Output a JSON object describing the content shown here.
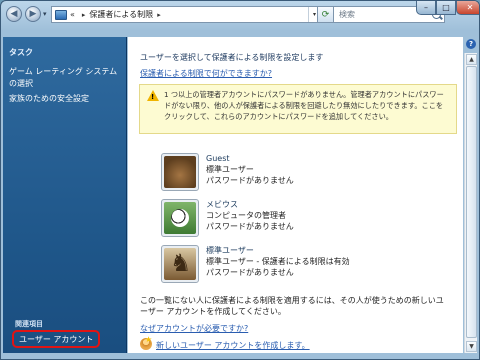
{
  "window": {
    "address_path": "保護者による制限",
    "address_chevron": "«",
    "search_placeholder": "検索",
    "buttons": {
      "minimize": "–",
      "maximize": "□",
      "close": "✕"
    },
    "help": "?"
  },
  "sidebar": {
    "heading": "タスク",
    "links": [
      "ゲーム レーティング システムの選択",
      "家族のための安全設定"
    ],
    "related_heading": "関連項目",
    "user_account": "ユーザー アカウント"
  },
  "main": {
    "title": "ユーザーを選択して保護者による制限を設定します",
    "faq_link": "保護者による制限で何ができますか?",
    "warning": "1 つ以上の管理者アカウントにパスワードがありません。管理者アカウントにパスワードがない限り、他の人が保護者による制限を回避したり無効にしたりできます。ここをクリックして、これらのアカウントにパスワードを追加してください。",
    "accounts": [
      {
        "name": "Guest",
        "type": "標準ユーザー",
        "status": "パスワードがありません",
        "picture": "cabinet-icon"
      },
      {
        "name": "メビウス",
        "type": "コンピュータの管理者",
        "status": "パスワードがありません",
        "picture": "soccer-ball-icon"
      },
      {
        "name": "標準ユーザー",
        "type": "標準ユーザー - 保護者による制限は有効",
        "status": "パスワードがありません",
        "picture": "chess-icon"
      }
    ],
    "footer_text": "この一覧にない人に保護者による制限を適用するには、その人が使うための新しいユーザー アカウントを作成してください。",
    "why_account_link": "なぜアカウントが必要ですか?",
    "create_account_link": "新しいユーザー アカウントを作成します。"
  }
}
